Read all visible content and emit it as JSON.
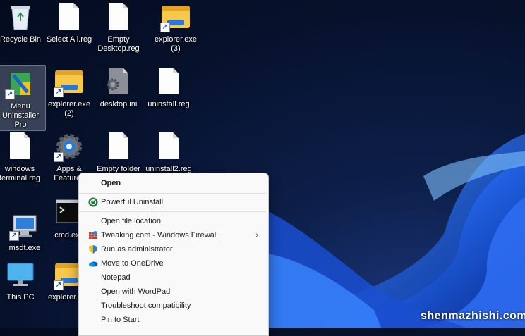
{
  "desktop_icons": [
    {
      "id": "recycle-bin",
      "label": "Recycle Bin",
      "icon": "recycle-bin-icon"
    },
    {
      "id": "select-all-reg",
      "label": "Select All.reg",
      "icon": "reg-file-icon"
    },
    {
      "id": "empty-desktop-reg",
      "label": "Empty\nDesktop.reg",
      "icon": "reg-file-icon"
    },
    {
      "id": "explorer-exe-3",
      "label": "explorer.exe\n(3)",
      "icon": "folder-shortcut-icon"
    },
    {
      "id": "menu-uninstaller-pro",
      "label": "Menu\nUninstaller\nPro",
      "icon": "uninstaller-app-icon"
    },
    {
      "id": "explorer-exe-2",
      "label": "explorer.exe\n(2)",
      "icon": "folder-shortcut-icon"
    },
    {
      "id": "desktop-ini",
      "label": "desktop.ini",
      "icon": "settings-file-icon"
    },
    {
      "id": "uninstall-reg",
      "label": "uninstall.reg",
      "icon": "reg-file-icon"
    },
    {
      "id": "windows-terminal-reg",
      "label": "windows\nterminal.reg",
      "icon": "reg-file-icon"
    },
    {
      "id": "apps-features",
      "label": "Apps &\nFeatures",
      "icon": "gear-icon"
    },
    {
      "id": "empty-folder",
      "label": "Empty folder",
      "icon": "reg-file-icon"
    },
    {
      "id": "uninstall2-reg",
      "label": "uninstall2.reg",
      "icon": "reg-file-icon"
    },
    {
      "id": "msdt-exe",
      "label": "msdt.exe",
      "icon": "msdt-app-icon"
    },
    {
      "id": "cmd-exe",
      "label": "cmd.exe",
      "icon": "cmd-icon"
    },
    {
      "id": "this-pc",
      "label": "This PC",
      "icon": "monitor-icon"
    },
    {
      "id": "explorer-exe",
      "label": "explorer.exe",
      "icon": "folder-shortcut-icon"
    }
  ],
  "context_menu": {
    "items": [
      {
        "label": "Open",
        "bold": true,
        "icon": ""
      },
      {
        "label": "Powerful Uninstall",
        "icon": "uninstall-power-icon"
      },
      {
        "label": "Open file location",
        "icon": ""
      },
      {
        "label": "Tweaking.com - Windows Firewall",
        "icon": "firewall-icon",
        "submenu": true
      },
      {
        "label": "Run as administrator",
        "icon": "uac-shield-icon"
      },
      {
        "label": "Move to OneDrive",
        "icon": "onedrive-cloud-icon"
      },
      {
        "label": "Notepad",
        "icon": ""
      },
      {
        "label": "Open with WordPad",
        "icon": ""
      },
      {
        "label": "Troubleshoot compatibility",
        "icon": ""
      },
      {
        "label": "Pin to Start",
        "icon": ""
      }
    ]
  },
  "watermark": "shenmazhishi.com",
  "colors": {
    "accent": "#2b78d4",
    "menu_bg": "#f9f9f9",
    "desktop_bg": "#06112b"
  }
}
